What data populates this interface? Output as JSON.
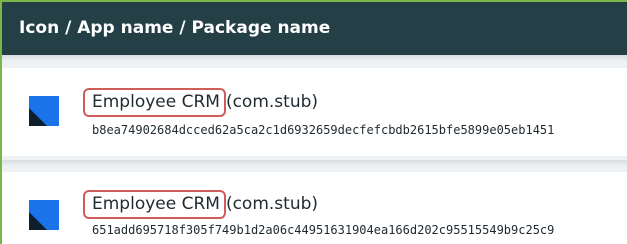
{
  "table": {
    "header": "Icon / App name / Package name"
  },
  "rows": [
    {
      "app_name": "Employee CRM",
      "package": "(com.stub)",
      "hash": "b8ea74902684dcced62a5ca2c1d6932659decfefcbdb2615bfe5899e05eb1451",
      "icon": "blue-square-app-icon"
    },
    {
      "app_name": "Employee CRM",
      "package": "(com.stub)",
      "hash": "651add695718f305f749b1d2a06c44951631904ea166d202c95515549b9c25c9",
      "icon": "blue-square-app-icon"
    }
  ],
  "colors": {
    "header_bg": "#243f46",
    "icon_blue": "#1a73e8",
    "icon_dark": "#0f1e2a",
    "highlight_border": "#d05c5c",
    "frame_accent": "#7ab648"
  }
}
